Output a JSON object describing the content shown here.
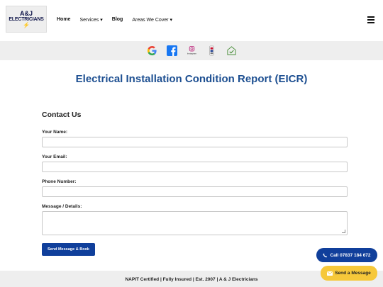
{
  "logo": {
    "line1": "A&J",
    "line2": "ELECTRICIANS",
    "bolt": "⚡"
  },
  "nav": [
    {
      "label": "Home",
      "bold": true
    },
    {
      "label": "Services ▾",
      "bold": false
    },
    {
      "label": "Blog",
      "bold": true
    },
    {
      "label": "Areas We Cover ▾",
      "bold": false
    }
  ],
  "social": {
    "icons": [
      "google-icon",
      "facebook-icon",
      "instagram-icon",
      "tradesperson-badge-icon",
      "checkatrade-icon"
    ],
    "instagram_text": "Instagram"
  },
  "page": {
    "title": "Electrical Installation Condition Report (EICR)"
  },
  "form": {
    "heading": "Contact Us",
    "name_label": "Your Name:",
    "email_label": "Your Email:",
    "phone_label": "Phone Number:",
    "message_label": "Message / Details:",
    "submit_label": "Send Message & Book"
  },
  "footer": {
    "text": "NAPIT Certified | Fully Insured | Est. 2007 | A & J Electricians"
  },
  "floating": {
    "call_label": "Call 07837 184 672",
    "message_label": "Send a Message"
  },
  "colors": {
    "brand_blue": "#103f9b",
    "title_blue": "#1d4f91",
    "message_yellow": "#f6c83a"
  }
}
